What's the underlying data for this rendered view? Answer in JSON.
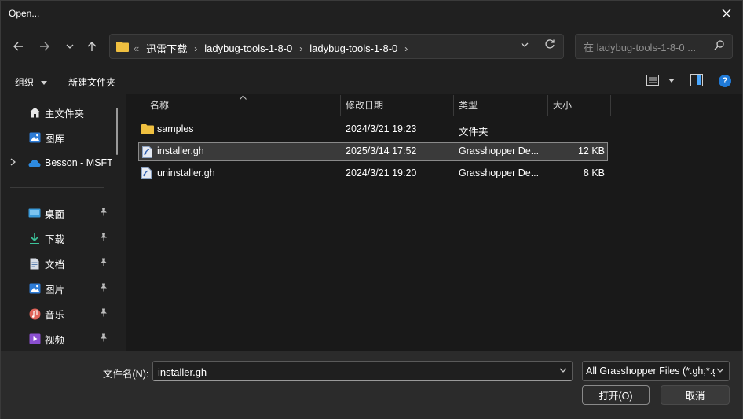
{
  "window": {
    "title": "Open..."
  },
  "nav": {
    "lead": "«",
    "breadcrumbs": [
      "迅雷下载",
      "ladybug-tools-1-8-0",
      "ladybug-tools-1-8-0"
    ]
  },
  "search": {
    "placeholder": "在 ladybug-tools-1-8-0 ..."
  },
  "toolbar": {
    "organize_label": "组织",
    "new_folder_label": "新建文件夹"
  },
  "sidebar": {
    "top_items": [
      {
        "label": "主文件夹",
        "icon": "home-icon"
      },
      {
        "label": "图库",
        "icon": "gallery-icon"
      },
      {
        "label": "Besson - MSFT",
        "icon": "cloud-icon"
      }
    ],
    "pinned_items": [
      {
        "label": "桌面",
        "icon": "desktop-icon"
      },
      {
        "label": "下载",
        "icon": "download-icon"
      },
      {
        "label": "文档",
        "icon": "document-icon"
      },
      {
        "label": "图片",
        "icon": "pictures-icon"
      },
      {
        "label": "音乐",
        "icon": "music-icon"
      },
      {
        "label": "视频",
        "icon": "video-icon"
      }
    ]
  },
  "files": {
    "columns": {
      "name": "名称",
      "modified": "修改日期",
      "type": "类型",
      "size": "大小"
    },
    "rows": [
      {
        "name": "samples",
        "modified": "2024/3/21 19:23",
        "type": "文件夹",
        "size": "",
        "icon": "folder-icon"
      },
      {
        "name": "installer.gh",
        "modified": "2025/3/14 17:52",
        "type": "Grasshopper De...",
        "size": "12 KB",
        "icon": "gh-file-icon"
      },
      {
        "name": "uninstaller.gh",
        "modified": "2024/3/21 19:20",
        "type": "Grasshopper De...",
        "size": "8 KB",
        "icon": "gh-file-icon"
      }
    ],
    "selected_index": 1
  },
  "footer": {
    "filename_label": "文件名(N):",
    "filename_value": "installer.gh",
    "filetype_value": "All Grasshopper Files (*.gh;*.ghx)",
    "open_label": "打开(O)",
    "cancel_label": "取消"
  },
  "colors": {
    "folder": "#f0c040",
    "accent": "#1f7ad8",
    "selected_bg": "#3a3a3a"
  }
}
